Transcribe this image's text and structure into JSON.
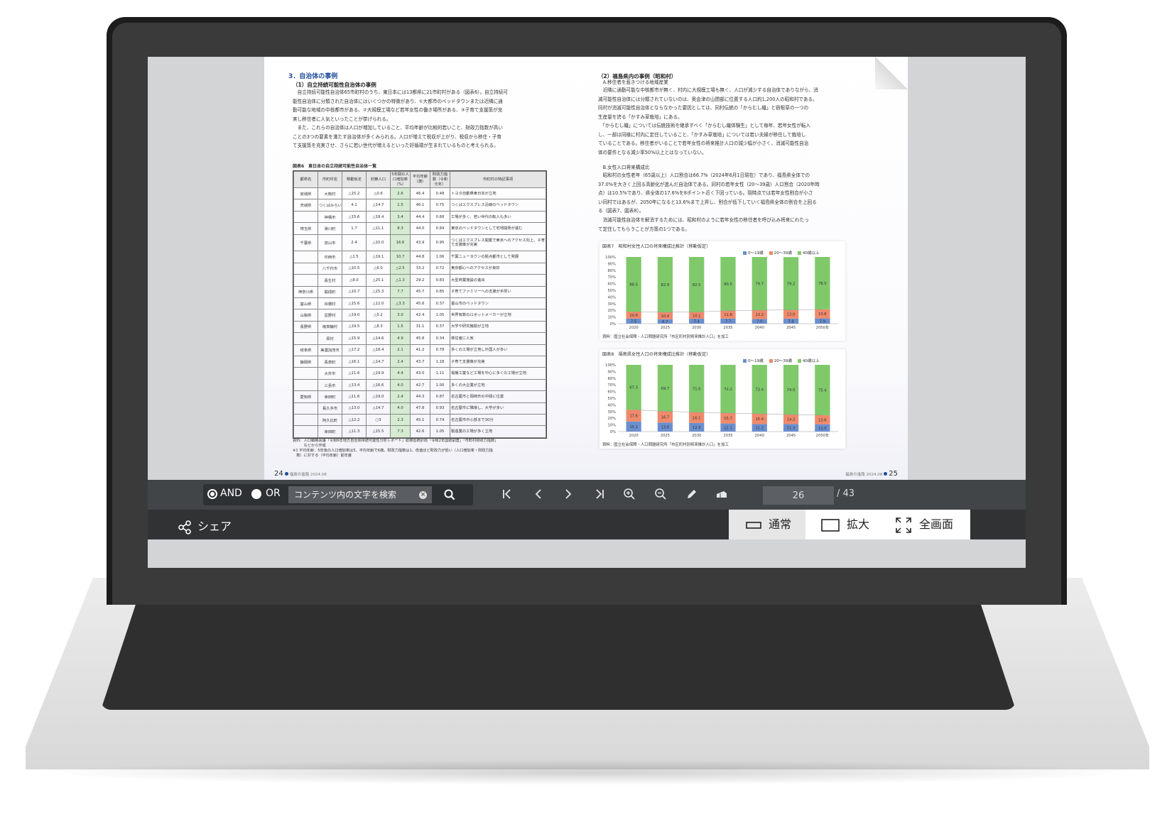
{
  "left_page": {
    "section_title": "3．自治体の事例",
    "subsection_title": "（1）自立持続可能性自治体の事例",
    "paragraph1": "　自立持続可能性自治体65市町村のうち、東日本には13都県に21市町村がある（図表6）。自立持続可\n能性自治体に分類された自治体にはいくつかの特徴があり、①大都市のベッドタウンまたは近隣に通\n勤可能な地域の中核都市がある、②大規模工場など若年女性の働き場所がある、③子育て支援策が充\n実し移住者に人気といったことが挙げられる。",
    "paragraph2": "　また、これらの自治体は人口が増加していること、平均年齢が比較的若いこと、財政力指数が高い\nことの3つの要素を満たす自治体が多くみられる。人口が増えて税収が上がり、税収から移住・子育\nて支援策を充実させ、さらに若い世代が増えるといった好循環が生まれているものと考えられる。",
    "table_title": "図表6　東日本の自立持続可能性自治体一覧",
    "table_headers": [
      "都県名",
      "市町村名",
      "移動仮定",
      "封鎖人口",
      "5年間の人口増加率（%）",
      "平均年齢（歳）",
      "財政力指数（令和元年）",
      "市町村の特記事項"
    ],
    "table_rows": [
      [
        "宮城県",
        "大衡村",
        "△15.2",
        "△0.6",
        "2.6",
        "46.4",
        "0.48",
        "トヨタ自動車東日本が立地"
      ],
      [
        "茨城県",
        "つくばみらい市",
        "4.1",
        "△14.7",
        "1.5",
        "46.1",
        "0.75",
        "つくばエクスプレス沿線のベッドタウン"
      ],
      [
        "",
        "神栖市",
        "△15.6",
        "△18.4",
        "3.4",
        "44.4",
        "0.68",
        "工場が多く、若い世代の転入も多い"
      ],
      [
        "埼玉県",
        "滑川町",
        "1.7",
        "△11.1",
        "8.3",
        "44.0",
        "0.84",
        "東京のベッドタウンとして宅地開発が進む"
      ],
      [
        "千葉県",
        "流山市",
        "2.4",
        "△10.0",
        "16.6",
        "43.9",
        "0.95",
        "つくばエクスプレス開業で東京へのアクセス向上、子育て支援策が充実"
      ],
      [
        "",
        "印西市",
        "△1.5",
        "△19.1",
        "10.7",
        "44.8",
        "1.06",
        "千葉ニュータウンの拠点都市として発展"
      ],
      [
        "",
        "八千代市",
        "△10.5",
        "△6.0",
        "△2.5",
        "33.2",
        "0.72",
        "東京都心へのアクセスが良好"
      ],
      [
        "",
        "長生村",
        "△8.0",
        "△25.1",
        "△1.3",
        "29.2",
        "0.83",
        "大型商業施設の進出"
      ],
      [
        "神奈川県",
        "開成町",
        "△10.7",
        "△15.3",
        "7.7",
        "45.7",
        "0.85",
        "子育てファミリーへの支援が手厚い"
      ],
      [
        "富山県",
        "舟橋村",
        "△15.6",
        "△12.0",
        "△3.3",
        "45.6",
        "0.37",
        "富山市のベッドタウン"
      ],
      [
        "山梨県",
        "忍野村",
        "△19.0",
        "△5.2",
        "3.0",
        "42.4",
        "1.05",
        "世界有数のロボットメーカーが立地"
      ],
      [
        "長野県",
        "南箕輪村",
        "△19.5",
        "△8.3",
        "1.5",
        "31.1",
        "0.37",
        "大学や研究機関が立地"
      ],
      [
        "",
        "原村",
        "△15.9",
        "△14.6",
        "4.9",
        "45.8",
        "0.34",
        "移住者に人気"
      ],
      [
        "岐阜県",
        "美濃加茂市",
        "△17.2",
        "△18.4",
        "2.1",
        "41.2",
        "0.78",
        "多くの工場が立地し外国人が多い"
      ],
      [
        "静岡県",
        "長泉町",
        "△16.1",
        "△14.7",
        "2.4",
        "43.7",
        "1.18",
        "子育て支援策が充実"
      ],
      [
        "",
        "大井市",
        "△11.6",
        "△19.9",
        "4.4",
        "43.0",
        "1.11",
        "電機工業など工場を中心に多くの工場が立地"
      ],
      [
        "",
        "三島市",
        "△13.4",
        "△16.6",
        "4.0",
        "42.7",
        "1.00",
        "多くの大企業が立地"
      ],
      [
        "愛知県",
        "幸田町",
        "△11.6",
        "△19.0",
        "2.4",
        "44.3",
        "0.87",
        "名古屋市と岡崎市の中間に位置"
      ],
      [
        "",
        "長久手市",
        "△13.0",
        "△14.7",
        "4.0",
        "47.8",
        "0.93",
        "名古屋市に隣接し、大学が多い"
      ],
      [
        "",
        "阿久比町",
        "△12.2",
        "○3",
        "2.3",
        "45.1",
        "0.74",
        "名古屋市中心部まで30分"
      ],
      [
        "",
        "幸田町",
        "△11.3",
        "△15.5",
        "7.3",
        "42.6",
        "1.05",
        "製造業の工場が多く立地"
      ]
    ],
    "table_source": "資料：人口戦略会議「令和6年地方自治体持続可能性分析レポート」総務省統計局「令和2年国勢調査」「市町村財政力指数」\n　　　などから作成\n※1 平均年齢：5年後の人口増加率は5、平均年齢で6歳。財政力指数は1、低値ほど財政力が低い（人口増加率・財政力指\n　数）に対する（平均年齢）前年度",
    "page_number": "24",
    "page_caption": "福島の進路 2024.08"
  },
  "right_page": {
    "subsection_title": "（2）福島県内の事例（昭和村）",
    "item_a": "　A.移住者を惹きつける地域産業",
    "paragraph1": "　近隣に通勤可能な中核都市が無く、村内に大規模工場も無く、人口が減少する自治体でありながら、消\n滅可能性自治体には分類されていないのは、奥会津の山間部に位置する人口約1,200人の昭和村である。\n同村が消滅可能性自治体とならなかった要因としては、同村伝統の「からむし織」と宿根草の一つの\n生産量を誇る「かすみ草栽培」にある。",
    "paragraph2": "　「からむし織」については伝統技術を継承すべく「からむし織体験生」として毎年、若年女性が転入\nし、一部は同様に村内に定住していること、「かすみ草栽培」については若い夫婦が移住して栽培し\nていることである。移住者がいることで若年女性の将来推計人口の減少幅が小さく、消滅可能性自治\n体の要件となる減少率50%以上とはなっていない。",
    "item_b": "　B.女性人口将来構成比",
    "paragraph3": "　昭和村の女性老年（65歳以上）人口割合は66.7%（2024年6月1日現在）であり、福島県全体での\n37.0%を大きく上回る高齢化が進んだ自治体である。同村の若年女性（20～39歳）人口割合（2020年時\n点）は10.5%であり、県全体の17.6%を8ポイント近く下回っている。現時点では若年女性割合が小さ\nい同村ではあるが、2050年になると13.6%まで上昇し、割合が低下していく福島県全体の割合を上回る\nる（図表7、図表8）。",
    "paragraph4": "　消滅可能性自治体を解消するためには、昭和村のように若年女性の移住者を呼び込み将来にわたっ\nて定住してもらうことが方策の1つである。",
    "page_number": "25",
    "page_caption": "福島の進路 2024.08"
  },
  "chart_data": [
    {
      "type": "bar",
      "stacked": true,
      "title": "図表7　昭和村女性人口の将来構成比推計（移動仮定）",
      "categories": [
        "2020",
        "2025",
        "2030",
        "2035",
        "2040",
        "2045",
        "2050年"
      ],
      "series": [
        {
          "name": "0～19歳",
          "color": "#6b8fcf",
          "values": [
            7.5,
            6.7,
            7.4,
            7.7,
            7.0,
            7.6,
            7.9
          ]
        },
        {
          "name": "20～39歳",
          "color": "#ef8a6b",
          "values": [
            10.5,
            10.4,
            10.1,
            11.8,
            13.2,
            13.0,
            13.6
          ]
        },
        {
          "name": "40歳以上",
          "color": "#7fc96a",
          "values": [
            82.0,
            82.9,
            82.5,
            80.5,
            79.7,
            79.2,
            78.5
          ]
        }
      ],
      "value_labels": [
        [
          "7.5",
          "6.7",
          "7.4",
          "7.7",
          "7.0",
          "7.8",
          "7.9"
        ],
        [
          "10.6",
          "10.4",
          "10.1",
          "11.8",
          "13.2",
          "13.0",
          "13.6"
        ],
        [
          "88.5",
          "82.9",
          "82.5",
          "80.5",
          "79.7",
          "79.2",
          "78.5"
        ]
      ],
      "y_ticks": [
        "0%",
        "10%",
        "20%",
        "30%",
        "40%",
        "50%",
        "60%",
        "70%",
        "80%",
        "90%",
        "100%"
      ],
      "ylim": [
        0,
        100
      ],
      "source": "資料：国立社会保障・人口問題研究所「市区町村別将来推計人口」を加工"
    },
    {
      "type": "bar",
      "stacked": true,
      "title": "図表8　福島県女性人口の将来構成比推計（移動仮定）",
      "categories": [
        "2020",
        "2025",
        "2030",
        "2035",
        "2040",
        "2045",
        "2050年"
      ],
      "series": [
        {
          "name": "0～19歳",
          "color": "#6b8fcf",
          "values": [
            15.1,
            13.6,
            12.9,
            12.1,
            11.2,
            11.3,
            11.0
          ]
        },
        {
          "name": "20～39歳",
          "color": "#ef8a6b",
          "values": [
            17.6,
            16.7,
            16.1,
            15.7,
            15.4,
            14.2,
            13.6
          ]
        },
        {
          "name": "40歳以上",
          "color": "#7fc96a",
          "values": [
            67.3,
            69.7,
            71.0,
            72.2,
            73.4,
            74.5,
            75.4
          ]
        }
      ],
      "value_labels": [
        [
          "15.1",
          "13.6",
          "12.9",
          "12.1",
          "11.2",
          "11.3",
          "11.0"
        ],
        [
          "17.6",
          "16.7",
          "16.1",
          "15.7",
          "15.4",
          "14.2",
          "13.6"
        ],
        [
          "67.3",
          "69.7",
          "71.0",
          "72.2",
          "73.4",
          "74.5",
          "75.4"
        ]
      ],
      "y_ticks": [
        "0%",
        "10%",
        "20%",
        "30%",
        "40%",
        "50%",
        "60%",
        "70%",
        "80%",
        "90%",
        "100%"
      ],
      "ylim": [
        0,
        100
      ],
      "source": "資料：国立社会保障・人口問題研究所「市区町村別将来推計人口」を加工"
    }
  ],
  "toolbar": {
    "and_label": "AND",
    "or_label": "OR",
    "search_placeholder": "コンテンツ内の文字を検索",
    "first_page_icon": "first-page-icon",
    "prev_page_icon": "chevron-left-icon",
    "next_page_icon": "chevron-right-icon",
    "last_page_icon": "last-page-icon",
    "zoom_in_icon": "zoom-in-icon",
    "zoom_out_icon": "zoom-out-icon",
    "pen_icon": "pen-icon",
    "eraser_icon": "eraser-icon",
    "current_page": "26",
    "total_pages": "/ 43"
  },
  "bottombar": {
    "share_label": "シェア",
    "view_normal": "通常",
    "view_zoom": "拡大",
    "view_fullscreen": "全画面"
  },
  "colors": {
    "toolbar_bg": "#414548",
    "bottombar_bg": "#303234",
    "accent_green": "#5cb82e",
    "section_blue": "#1d4b9a"
  }
}
